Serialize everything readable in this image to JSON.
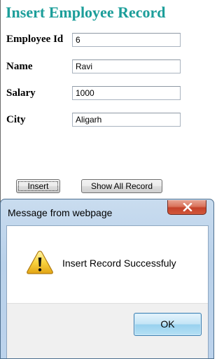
{
  "form": {
    "title": "Insert Employee Record",
    "fields": [
      {
        "label": "Employee Id",
        "value": "6"
      },
      {
        "label": "Name",
        "value": "Ravi"
      },
      {
        "label": "Salary",
        "value": "1000"
      },
      {
        "label": "City",
        "value": "Aligarh"
      }
    ],
    "insert_label": "Insert",
    "show_all_label": "Show All Record",
    "title_color": "#1c9e9a"
  },
  "dialog": {
    "title": "Message from webpage",
    "message": "Insert Record Successfuly",
    "ok_label": "OK",
    "icon": "warning-icon",
    "close_icon": "close-icon",
    "close_color": "#c4422a"
  }
}
